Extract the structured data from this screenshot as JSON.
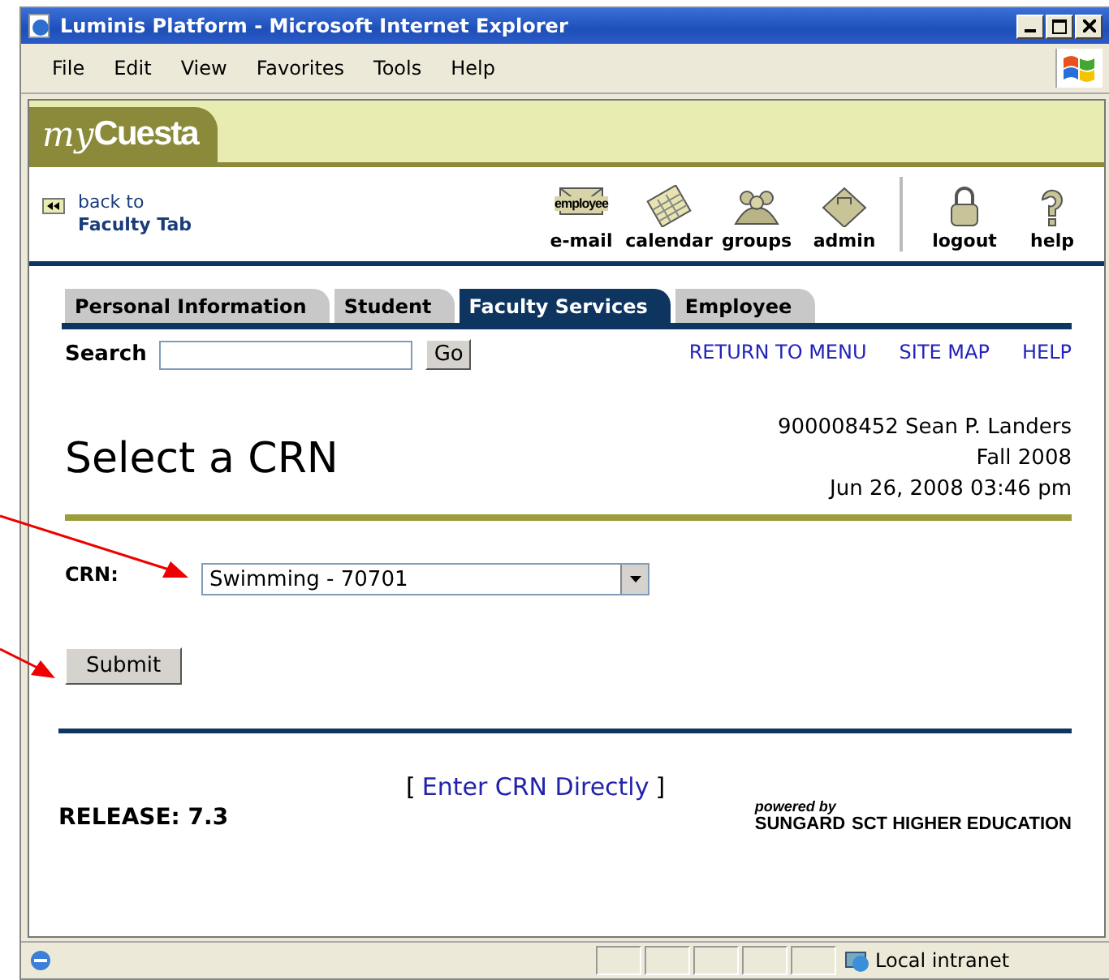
{
  "window": {
    "title": "Luminis Platform - Microsoft Internet Explorer"
  },
  "menu": [
    "File",
    "Edit",
    "View",
    "Favorites",
    "Tools",
    "Help"
  ],
  "header": {
    "logo_prefix": "my",
    "logo_main": "Cuesta"
  },
  "back_link": {
    "line1": "back to",
    "line2": "Faculty Tab"
  },
  "nav_items": [
    {
      "kind": "email",
      "label": "e-mail",
      "badge": "employee"
    },
    {
      "kind": "calendar",
      "label": "calendar"
    },
    {
      "kind": "groups",
      "label": "groups"
    },
    {
      "kind": "admin",
      "label": "admin"
    },
    {
      "kind": "logout",
      "label": "logout"
    },
    {
      "kind": "help",
      "label": "help"
    }
  ],
  "tabs": [
    {
      "label": "Personal Information",
      "selected": false
    },
    {
      "label": "Student",
      "selected": false
    },
    {
      "label": "Faculty Services",
      "selected": true
    },
    {
      "label": "Employee",
      "selected": false
    }
  ],
  "search": {
    "label": "Search",
    "button": "Go"
  },
  "links": [
    "RETURN TO MENU",
    "SITE MAP",
    "HELP"
  ],
  "page_title": "Select a CRN",
  "user_info": [
    "900008452 Sean P. Landers",
    "Fall 2008",
    "Jun 26, 2008 03:46 pm"
  ],
  "crn": {
    "label": "CRN:",
    "value": "Swimming - 70701"
  },
  "submit": "Submit",
  "footer": {
    "link": "Enter CRN Directly",
    "open": "[",
    "close": "]",
    "release": "RELEASE: 7.3",
    "powered_by": "powered by",
    "brand": "SUNGARD",
    "brand_rest": "SCT HIGHER EDUCATION"
  },
  "status_bar": {
    "zone": "Local intranet"
  }
}
